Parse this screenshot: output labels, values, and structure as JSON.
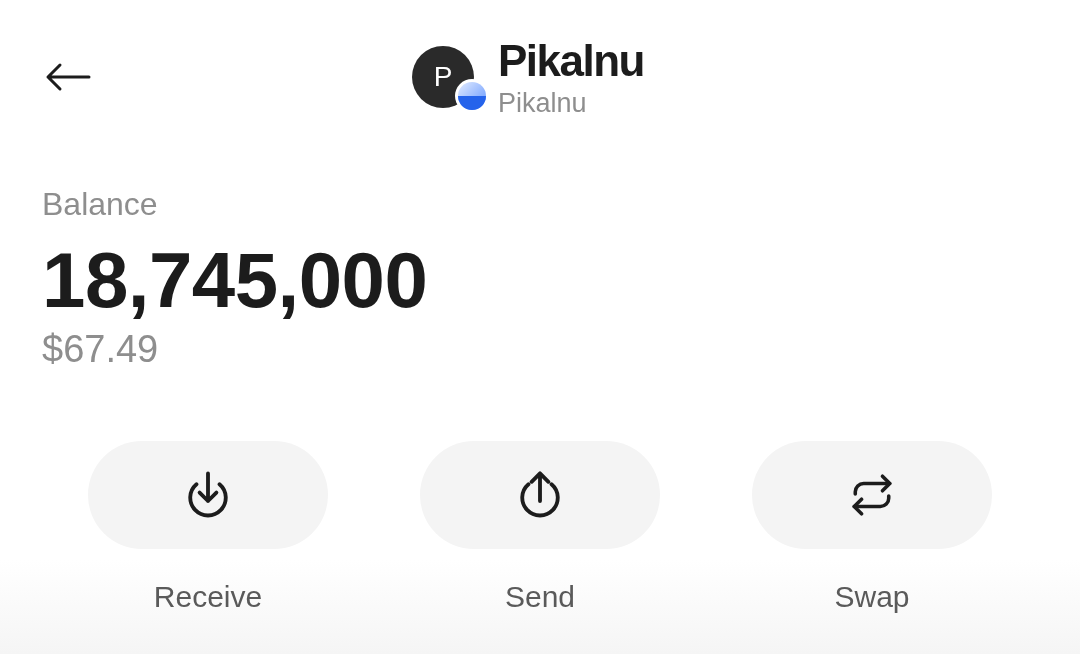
{
  "header": {
    "avatar_letter": "P",
    "title": "Pikalnu",
    "subtitle": "Pikalnu"
  },
  "balance": {
    "label": "Balance",
    "amount": "18,745,000",
    "fiat": "$67.49"
  },
  "actions": [
    {
      "kind": "receive",
      "label": "Receive"
    },
    {
      "kind": "send",
      "label": "Send"
    },
    {
      "kind": "swap",
      "label": "Swap"
    }
  ]
}
